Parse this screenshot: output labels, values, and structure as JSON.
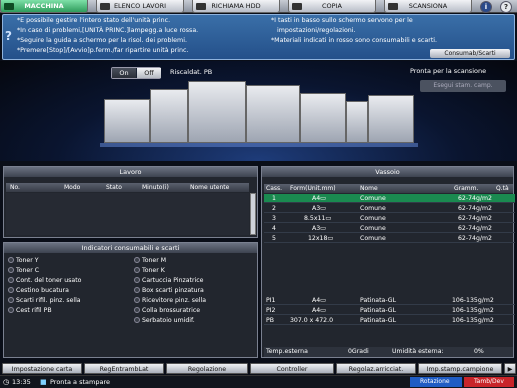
{
  "tabs": [
    {
      "label": "MACCHINA",
      "active": true,
      "icon": "machine-icon"
    },
    {
      "label": "ELENCO LAVORI",
      "active": false,
      "icon": "job-list-icon"
    },
    {
      "label": "RICHIAMA HDD",
      "active": false,
      "icon": "hdd-icon"
    },
    {
      "label": "COPIA",
      "active": false,
      "icon": "copy-icon"
    },
    {
      "label": "SCANSIONA",
      "active": false,
      "icon": "scan-icon"
    }
  ],
  "header_buttons": {
    "help": "i",
    "user": "?"
  },
  "info": {
    "left": [
      "*E possibile gestire l'intero stato dell'unità princ.",
      "*In caso di problemi,[UNITÀ PRINC.]lampegg.a luce rossa.",
      "*Seguire la guida a schermo per la risol. dei problemi.",
      "*Premere[Stop]/[Avvio]p.ferm./far ripartire unità princ."
    ],
    "right": [
      "*I tasti in basso sullo schermo servono per le",
      "impostazioni/regolazioni.",
      "*Materiali indicati in rosso sono consumabili e scarti."
    ],
    "button": "Consumab/Scarti"
  },
  "machine": {
    "on": "On",
    "off": "Off",
    "heating": "Riscaldat. PB",
    "ready": "Pronta per la scansione",
    "exec_button": "Esegui stam. camp."
  },
  "lavoro": {
    "title": "Lavoro",
    "columns": [
      "No.",
      "Modo",
      "Stato",
      "Minuto(i)",
      "Nome utente"
    ]
  },
  "consumables": {
    "title": "Indicatori consumabili e scarti",
    "left": [
      "Toner Y",
      "Toner C",
      "Cont. del toner usato",
      "Cestino bucatura",
      "Scarti rifil. pinz. sella",
      "Cest rifil PB"
    ],
    "right": [
      "Toner M",
      "Toner K",
      "Cartuccia Pinzatrice",
      "Box scarti pinzatura",
      "Ricevitore pinz. sella",
      "Colla brossuratrice",
      "Serbatoio umidif."
    ]
  },
  "vassoio": {
    "title": "Vassoio",
    "columns": [
      "Cass.",
      "Form(Unit.mm)",
      "Nome",
      "Gramm.",
      "Q.tà"
    ],
    "rows": [
      {
        "cass": "1",
        "form": "A4▭",
        "name": "Comune",
        "gramm": "62-74g/m2",
        "sel": true
      },
      {
        "cass": "2",
        "form": "A3▭",
        "name": "Comune",
        "gramm": "62-74g/m2",
        "sel": false
      },
      {
        "cass": "3",
        "form": "8.5x11▭",
        "name": "Comune",
        "gramm": "62-74g/m2",
        "sel": false
      },
      {
        "cass": "4",
        "form": "A3▭",
        "name": "Comune",
        "gramm": "62-74g/m2",
        "sel": false
      },
      {
        "cass": "5",
        "form": "12x18▭",
        "name": "Comune",
        "gramm": "62-74g/m2",
        "sel": false
      }
    ],
    "pi_rows": [
      {
        "cass": "PI1",
        "form": "A4▭",
        "name": "Patinata-GL",
        "gramm": "106-135g/m2"
      },
      {
        "cass": "PI2",
        "form": "A4▭",
        "name": "Patinata-GL",
        "gramm": "106-135g/m2"
      },
      {
        "cass": "PB",
        "form": "307.0 x 472.0",
        "name": "Patinata-GL",
        "gramm": "106-135g/m2"
      }
    ],
    "temp_label": "Temp.esterna",
    "temp_value": "0Gradi",
    "hum_label": "Umidità esterna:",
    "hum_value": "0%"
  },
  "bottom_buttons": [
    "Impostazione carta",
    "RegEntrambLat",
    "Regolazione",
    "Controller",
    "Regolaz.arricciat.",
    "Imp.stamp.campione"
  ],
  "status": {
    "time": "13:35",
    "message": "Pronta a stampare",
    "rotation": "Rotazione",
    "toner": "Tamb/Dev"
  },
  "colors": {
    "active_tab": "#2f9c5c",
    "info_bg": "#2a5a94",
    "selected_row": "#1a8a50"
  }
}
